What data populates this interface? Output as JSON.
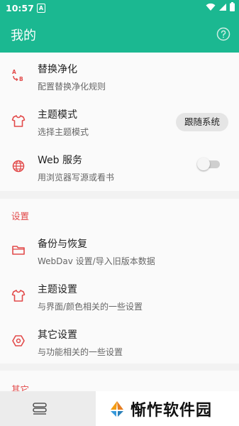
{
  "status_bar": {
    "time": "10:57",
    "notification_letter": "A"
  },
  "app_bar": {
    "title": "我的"
  },
  "colors": {
    "accent": "#1bb891",
    "icon_red": "#e24a4a"
  },
  "top_items": [
    {
      "label": "替换净化",
      "desc": "配置替换净化规则",
      "icon": "replace-icon"
    },
    {
      "label": "主题模式",
      "desc": "选择主题模式",
      "icon": "shirt-icon",
      "value": "跟随系统"
    },
    {
      "label": "Web 服务",
      "desc": "用浏览器写源或看书",
      "icon": "globe-icon",
      "enabled": false
    }
  ],
  "settings_section": {
    "title": "设置",
    "items": [
      {
        "label": "备份与恢复",
        "desc": "WebDav 设置/导入旧版本数据",
        "icon": "folder-icon"
      },
      {
        "label": "主题设置",
        "desc": "与界面/颜色相关的一些设置",
        "icon": "shirt-icon"
      },
      {
        "label": "其它设置",
        "desc": "与功能相关的一些设置",
        "icon": "hexagon-settings-icon"
      }
    ]
  },
  "other_section": {
    "title": "其它"
  },
  "watermark": {
    "text": "惭怍软件园"
  }
}
